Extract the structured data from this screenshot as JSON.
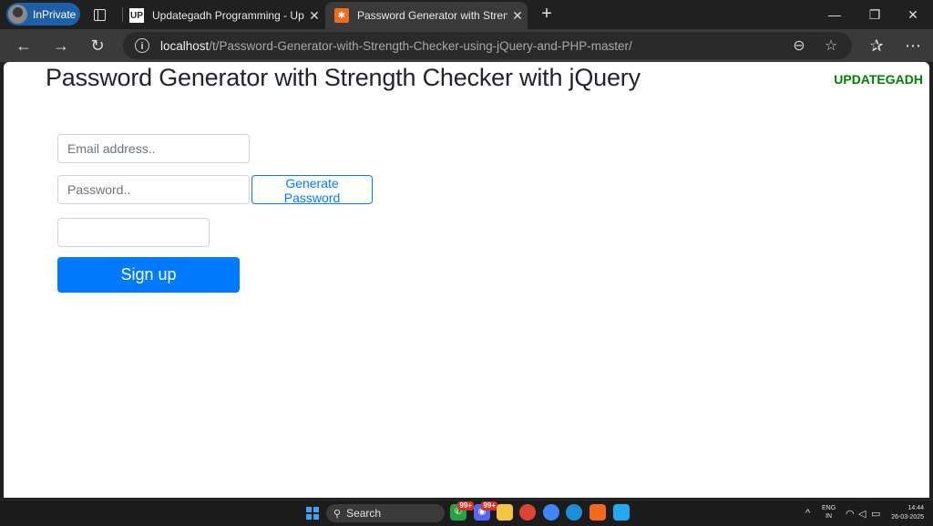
{
  "browser": {
    "inprivate_label": "InPrivate",
    "tabs": [
      {
        "favicon": "UP",
        "title": "Updategadh Programming - Upd",
        "close": "✕"
      },
      {
        "favicon": "✱",
        "title": "Password Generator with Strength",
        "close": "✕"
      }
    ],
    "new_tab": "+",
    "window_controls": {
      "minimize": "—",
      "restore": "❐",
      "close": "✕"
    },
    "nav": {
      "back": "←",
      "forward": "→",
      "reload": "↻"
    },
    "url_host": "localhost",
    "url_path": "/t/Password-Generator-with-Strength-Checker-using-jQuery-and-PHP-master/",
    "info_icon": "i",
    "zoom_icon": "⊖",
    "favorite_icon": "☆",
    "favorites_bar_icon": "✰",
    "more_icon": "⋯"
  },
  "page": {
    "title": "Password Generator with Strength Checker with jQuery",
    "brand": "UPDATEGADH",
    "email_placeholder": "Email address..",
    "password_placeholder": "Password..",
    "generate_label": "Generate Password",
    "strength_value": "",
    "signup_label": "Sign up"
  },
  "taskbar": {
    "search_label": "Search",
    "badge_a": "99+",
    "badge_b": "99+",
    "lang_line1": "ENG",
    "lang_line2": "IN",
    "time": "14:44",
    "date": "26-03-2025",
    "chevron": "^"
  },
  "colors": {
    "primary": "#007bff",
    "brand_green": "#008000",
    "inprivate": "#1f5fa8"
  }
}
